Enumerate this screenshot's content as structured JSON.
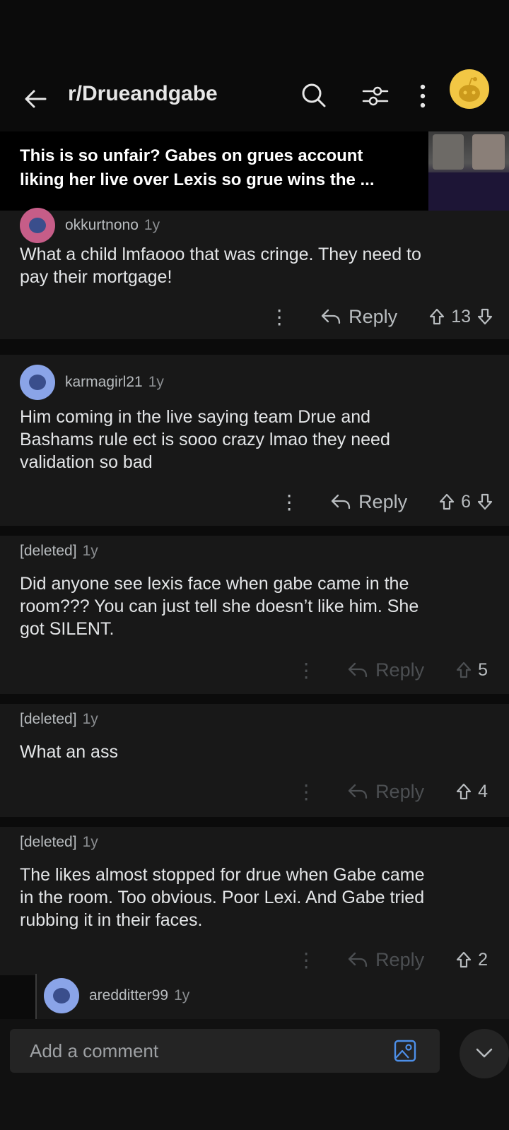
{
  "header": {
    "subreddit": "r/Drueandgabe",
    "back_icon": "arrow-left-icon",
    "search_icon": "search-icon",
    "filter_icon": "sort-filter-icon",
    "more_icon": "more-vertical-icon",
    "avatar_icon": "user-avatar-icon"
  },
  "post": {
    "title_line1": "This is so unfair? Gabes on grues account",
    "title_line2": "liking her live over Lexis so grue wins the ..."
  },
  "comments": [
    {
      "user": "okkurtnono",
      "time": "1y",
      "body_line1": "What a child lmfaooo that was cringe. They need to",
      "body_line2": "pay their mortgage!",
      "reply_label": "Reply",
      "votes": "13"
    },
    {
      "user": "karmagirl21",
      "time": "1y",
      "body_line1": "Him coming in the live saying team Drue and",
      "body_line2": "Bashams rule ect is sooo crazy lmao they need",
      "body_line3": "validation so bad",
      "reply_label": "Reply",
      "votes": "6"
    },
    {
      "user": "[deleted]",
      "time": "1y",
      "body_line1": "Did anyone see lexis face when gabe came in the",
      "body_line2": "room??? You can just tell she doesn’t like him. She",
      "body_line3": "got SILENT.",
      "reply_label": "Reply",
      "votes": "5"
    },
    {
      "user": "[deleted]",
      "time": "1y",
      "body_line1": "What an ass",
      "reply_label": "Reply",
      "votes": "4"
    },
    {
      "user": "[deleted]",
      "time": "1y",
      "body_line1": "The likes almost stopped for drue when Gabe came",
      "body_line2": "in the room. Too obvious. Poor Lexi. And Gabe tried",
      "body_line3": "rubbing it in their faces.",
      "reply_label": "Reply",
      "votes": "2"
    }
  ],
  "nested_reply": {
    "user": "aredditter99",
    "time": "1y"
  },
  "composer": {
    "placeholder": "Add a comment",
    "image_icon": "image-attach-icon",
    "scroll_icon": "chevron-down-icon"
  },
  "colors": {
    "background": "#0b0b0b",
    "card": "#181818",
    "avatar_yellow": "#f2c744",
    "avatar_blue": "#8aa4e8"
  }
}
